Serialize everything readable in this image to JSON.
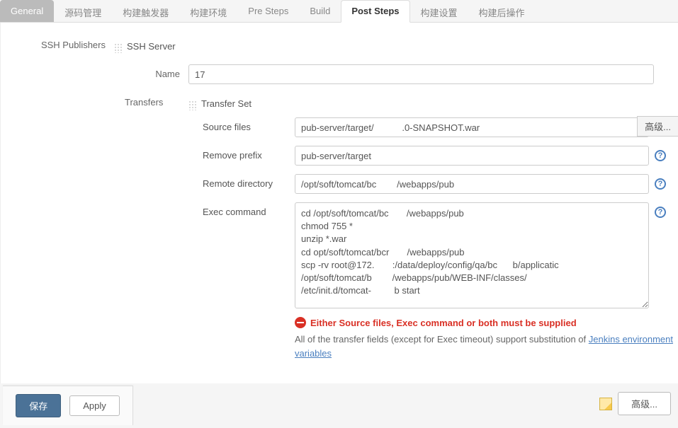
{
  "tabs": [
    "General",
    "源码管理",
    "构建触发器",
    "构建环境",
    "Pre Steps",
    "Build",
    "Post Steps",
    "构建设置",
    "构建后操作"
  ],
  "left": {
    "ssh_publishers": "SSH Publishers",
    "transfers": "Transfers"
  },
  "ssh_server": {
    "heading": "SSH Server",
    "name_label": "Name",
    "name_value": "17"
  },
  "transfer_set": {
    "heading": "Transfer Set",
    "source_files_label": "Source files",
    "source_files_value": "pub-server/target/           .0-SNAPSHOT.war",
    "remove_prefix_label": "Remove prefix",
    "remove_prefix_value": "pub-server/target",
    "remote_dir_label": "Remote directory",
    "remote_dir_value": "/opt/soft/tomcat/bc        /webapps/pub",
    "exec_label": "Exec command",
    "exec_value": "cd /opt/soft/tomcat/bc       /webapps/pub\nchmod 755 *\nunzip *.war\ncd opt/soft/tomcat/bcr       /webapps/pub\nscp -rv root@172.       :/data/deploy/config/qa/bc      b/applicatic\n/opt/soft/tomcat/b        /webapps/pub/WEB-INF/classes/\n/etc/init.d/tomcat-         b start"
  },
  "error": "Either Source files, Exec command or both must be supplied",
  "hint": {
    "prefix": "All of the transfer fields (except for Exec timeout) support substitution of ",
    "link": "Jenkins environment variables"
  },
  "buttons": {
    "advanced": "高级...",
    "save": "保存",
    "apply": "Apply",
    "advanced2": "高级..."
  }
}
